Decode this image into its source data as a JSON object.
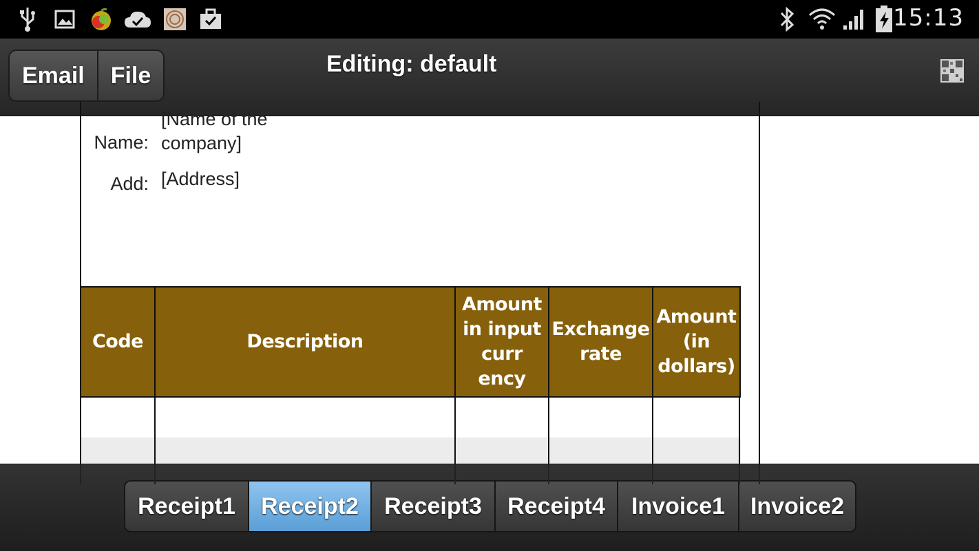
{
  "status_bar": {
    "time": "15:13",
    "left_icons": [
      "usb-icon",
      "image-icon",
      "app-fruit-icon",
      "cloud-check-icon",
      "stamp-icon",
      "briefcase-check-icon"
    ],
    "right_icons": [
      "bluetooth-icon",
      "wifi-icon",
      "signal-icon",
      "battery-charging-icon"
    ]
  },
  "action_bar": {
    "buttons": [
      "Email",
      "File"
    ],
    "title": "Editing: default",
    "right_icon": "qr-code-icon"
  },
  "document": {
    "fields": [
      {
        "label": "Name:",
        "value_line1": "[Name of the",
        "value_line2": "company]"
      },
      {
        "label": "Add:",
        "value": "[Address]"
      }
    ],
    "table": {
      "header_color": "#86600a",
      "columns": [
        {
          "label": "Code"
        },
        {
          "label": "Description"
        },
        {
          "label": "Amount in input curr ency"
        },
        {
          "label": "Exchange rate"
        },
        {
          "label": "Amount (in dollars)"
        }
      ],
      "row_colors": [
        "#ffffff",
        "#ececec"
      ]
    }
  },
  "bottom_tabs": {
    "items": [
      "Receipt1",
      "Receipt2",
      "Receipt3",
      "Receipt4",
      "Invoice1",
      "Invoice2"
    ],
    "active": "Receipt2",
    "active_color": "#6aaee3"
  }
}
